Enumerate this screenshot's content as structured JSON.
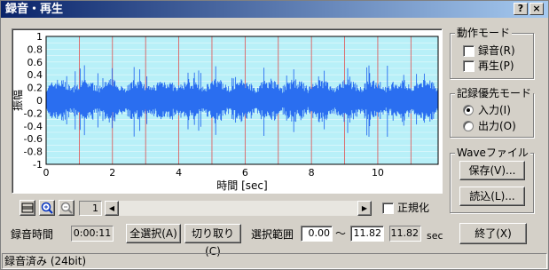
{
  "window": {
    "title": "録音・再生",
    "help_label": "?",
    "close_label": "×"
  },
  "chart_data": {
    "type": "line",
    "xlabel": "時間 [sec]",
    "ylabel": "振幅",
    "xlim": [
      0,
      11.82
    ],
    "ylim": [
      -1,
      1
    ],
    "x_ticks": [
      0,
      2,
      4,
      6,
      8,
      10
    ],
    "y_ticks": [
      1,
      0.8,
      0.6,
      0.4,
      0.2,
      0,
      -0.2,
      -0.4,
      -0.6,
      -0.8,
      -1
    ],
    "y_tick_labels": [
      "1",
      "0.8",
      "0.6",
      "0.4",
      "0.2",
      "0",
      "-0.2",
      "-0.4",
      "-0.6",
      "-0.8",
      "-1"
    ],
    "grid": true,
    "series": [
      {
        "envelope_peak": 0.55,
        "typical_amplitude": 0.2,
        "color": "#2a6ef0"
      }
    ],
    "background_color": "#b8f0f8",
    "grid_color": "#e05050"
  },
  "toolbar": {
    "page_value": "1"
  },
  "normalize": {
    "label": "正規化",
    "checked": false
  },
  "recording_time": {
    "label": "録音時間",
    "value": "0:00:11"
  },
  "buttons": {
    "select_all": "全選択(A)",
    "cut": "切り取り(C)",
    "done": "終了(X)"
  },
  "selection_range": {
    "label": "選択範囲",
    "start": "0.00",
    "tilde": "～",
    "end": "11.82",
    "length": "11.82",
    "unit": "sec"
  },
  "operation_mode": {
    "title": "動作モード",
    "record_label": "録音(R)",
    "play_label": "再生(P)"
  },
  "priority_mode": {
    "title": "記録優先モード",
    "input_label": "入力(I)",
    "output_label": "出力(O)",
    "selected": "input"
  },
  "wave_file": {
    "title": "Waveファイル",
    "save_label": "保存(V)...",
    "load_label": "読込(L)..."
  },
  "status": {
    "text": "録音済み (24bit)"
  }
}
